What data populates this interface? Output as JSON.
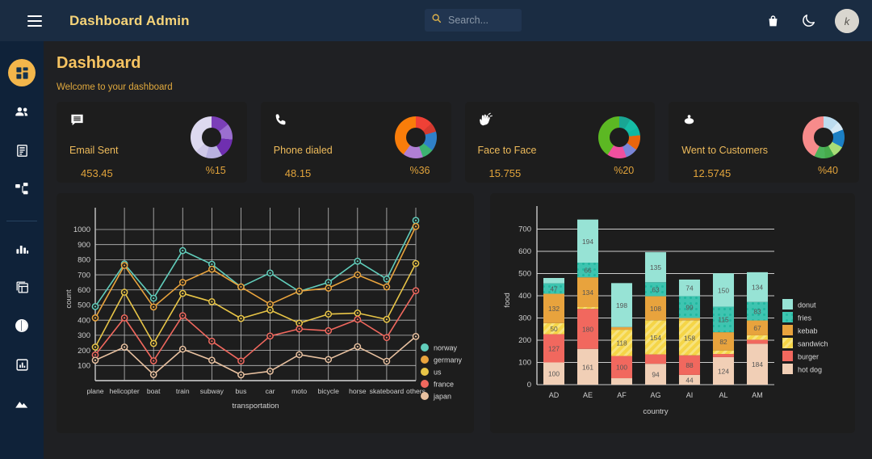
{
  "topbar": {
    "menu_icon": "hamburger-icon",
    "brand": "Dashboard Admin",
    "search": {
      "placeholder": "Search...",
      "value": "",
      "icon": "search-icon"
    },
    "icons": [
      {
        "name": "shopping-bag-icon",
        "label": "Cart"
      },
      {
        "name": "moon-icon",
        "label": "Dark mode"
      }
    ],
    "avatar": {
      "name": "user-avatar",
      "initials": "K"
    }
  },
  "sidebar": {
    "items": [
      {
        "name": "sidebar-item-dashboard",
        "icon": "dashboard-grid-icon",
        "active": true
      },
      {
        "name": "sidebar-item-team",
        "icon": "people-icon",
        "active": false
      },
      {
        "name": "sidebar-item-invoices",
        "icon": "receipt-icon",
        "active": false
      },
      {
        "name": "sidebar-item-org-chart",
        "icon": "sitemap-icon",
        "active": false
      },
      {
        "name": "sidebar-item-bar-chart",
        "icon": "bar-chart-icon",
        "active": false
      },
      {
        "name": "sidebar-item-pivot-table",
        "icon": "table-icon",
        "active": false
      },
      {
        "name": "sidebar-item-pie-chart",
        "icon": "pie-chart-icon",
        "active": false
      },
      {
        "name": "sidebar-item-stats",
        "icon": "chart-box-icon",
        "active": false
      },
      {
        "name": "sidebar-item-geography",
        "icon": "mountains-icon",
        "active": false
      }
    ]
  },
  "page": {
    "title": "Dashboard",
    "subtitle": "Welcome to your dashboard"
  },
  "stat_cards": [
    {
      "label": "Email Sent",
      "value": "453.45",
      "percent": "%15",
      "icon": "email-message-icon",
      "donut_colors": [
        "#d9d5ec",
        "#8e44c8",
        "#6f2fb0",
        "#b9b2e0",
        "#d9d5ec"
      ]
    },
    {
      "label": "Phone dialed",
      "value": "48.15",
      "percent": "%36",
      "icon": "phone-icon",
      "donut_colors": [
        "#ef4136",
        "#2f80c9",
        "#3cb371",
        "#b07fd4",
        "#f97d0a"
      ]
    },
    {
      "label": "Face to Face",
      "value": "15.755",
      "percent": "%20",
      "icon": "waving-hand-icon",
      "donut_colors": [
        "#1aa393",
        "#0fb8a3",
        "#e8650d",
        "#7b86d8",
        "#f0509f",
        "#5cb823"
      ]
    },
    {
      "label": "Went to Customers",
      "value": "12.5745",
      "percent": "%40",
      "icon": "traffic-cone-icon",
      "donut_colors": [
        "#bcdcef",
        "#1b7fc4",
        "#a8dd77",
        "#4aa košice",
        "#f78b8b"
      ]
    }
  ],
  "chart_data": [
    {
      "type": "line",
      "title": "",
      "xlabel": "transportation",
      "ylabel": "count",
      "ylim": [
        0,
        1080
      ],
      "yticks": [
        100,
        200,
        300,
        400,
        500,
        600,
        700,
        800,
        900,
        1000
      ],
      "grid": true,
      "legend_position": "right",
      "categories": [
        "plane",
        "helicopter",
        "boat",
        "train",
        "subway",
        "bus",
        "car",
        "moto",
        "bicycle",
        "horse",
        "skateboard",
        "others"
      ],
      "series": [
        {
          "name": "norway",
          "color": "#61cdbb",
          "values": [
            490,
            772,
            545,
            860,
            770,
            620,
            712,
            590,
            650,
            790,
            672,
            1060
          ]
        },
        {
          "name": "germany",
          "color": "#e8a33d",
          "values": [
            415,
            762,
            487,
            650,
            737,
            620,
            505,
            592,
            612,
            700,
            620,
            1020
          ]
        },
        {
          "name": "us",
          "color": "#e8c547",
          "values": [
            222,
            585,
            246,
            577,
            522,
            411,
            467,
            380,
            440,
            447,
            405,
            775
          ]
        },
        {
          "name": "france",
          "color": "#f1685e",
          "values": [
            170,
            415,
            131,
            430,
            261,
            130,
            295,
            342,
            330,
            405,
            285,
            595
          ]
        },
        {
          "name": "japan",
          "color": "#e8c1a0",
          "values": [
            135,
            222,
            40,
            208,
            135,
            38,
            62,
            172,
            140,
            225,
            128,
            292
          ]
        }
      ]
    },
    {
      "type": "bar",
      "stacked": true,
      "title": "",
      "xlabel": "country",
      "ylabel": "food",
      "ylim": [
        0,
        760
      ],
      "yticks": [
        0,
        100,
        200,
        300,
        400,
        500,
        600,
        700
      ],
      "grid": true,
      "legend_position": "right",
      "categories": [
        "AD",
        "AE",
        "AF",
        "AG",
        "AI",
        "AL",
        "AM"
      ],
      "series": [
        {
          "name": "hot dog",
          "color": "#f1cfb6",
          "pattern": "none",
          "values": [
            100,
            161,
            29,
            94,
            44,
            124,
            184
          ]
        },
        {
          "name": "burger",
          "color": "#f1685e",
          "pattern": "none",
          "values": [
            127,
            180,
            100,
            42,
            88,
            14,
            18
          ]
        },
        {
          "name": "sandwich",
          "color": "#f5d547",
          "pattern": "stripes",
          "values": [
            50,
            8,
            118,
            154,
            158,
            16,
            20
          ]
        },
        {
          "name": "kebab",
          "color": "#e8a33d",
          "pattern": "none",
          "values": [
            132,
            134,
            12,
            108,
            10,
            82,
            67
          ]
        },
        {
          "name": "fries",
          "color": "#3ec4b0",
          "pattern": "dots",
          "values": [
            47,
            66,
            0,
            63,
            99,
            115,
            83
          ]
        },
        {
          "name": "donut",
          "color": "#97e3d5",
          "pattern": "none",
          "values": [
            24,
            194,
            198,
            135,
            74,
            150,
            134
          ]
        }
      ]
    }
  ]
}
